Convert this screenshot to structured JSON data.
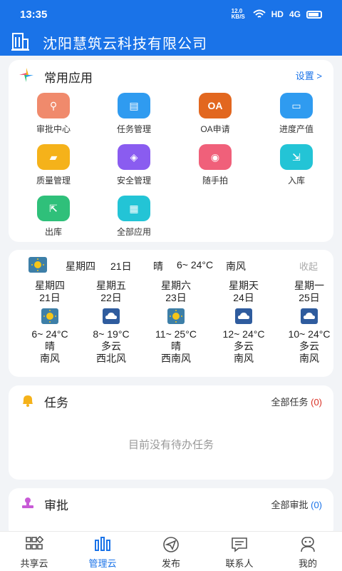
{
  "status_bar": {
    "time": "13:35",
    "net_speed": "12.0 KB/S",
    "hd": "HD",
    "signal": "4G"
  },
  "header": {
    "title": "沈阳慧筑云科技有限公司"
  },
  "apps": {
    "title": "常用应用",
    "settings": "设置 >",
    "items": [
      {
        "label": "审批中心",
        "icon": "stamp-icon",
        "color": "#f08a6c",
        "glyph": "⚲"
      },
      {
        "label": "任务管理",
        "icon": "clipboard-icon",
        "color": "#2f9bf0",
        "glyph": "▤"
      },
      {
        "label": "OA申请",
        "icon": "oa-icon",
        "color": "#e2671f",
        "glyph": "OA"
      },
      {
        "label": "进度产值",
        "icon": "progress-icon",
        "color": "#2f9bf0",
        "glyph": "▭"
      },
      {
        "label": "质量管理",
        "icon": "quality-folder-icon",
        "color": "#f5b21a",
        "glyph": "▰"
      },
      {
        "label": "安全管理",
        "icon": "shield-icon",
        "color": "#8a5cf0",
        "glyph": "◈"
      },
      {
        "label": "随手拍",
        "icon": "camera-icon",
        "color": "#f0607a",
        "glyph": "◉"
      },
      {
        "label": "入库",
        "icon": "stock-in-icon",
        "color": "#23c4d6",
        "glyph": "⇲"
      },
      {
        "label": "出库",
        "icon": "stock-out-icon",
        "color": "#2fc07a",
        "glyph": "⇱"
      },
      {
        "label": "全部应用",
        "icon": "all-apps-icon",
        "color": "#23c4d6",
        "glyph": "▦"
      }
    ]
  },
  "weather": {
    "today": {
      "weekday": "星期四",
      "date": "21日",
      "cond": "晴",
      "temp": "6~ 24°C",
      "wind": "南风"
    },
    "collapse": "收起",
    "days": [
      {
        "weekday": "星期四",
        "date": "21日",
        "icon": "sunny-icon",
        "temp": "6~ 24°C",
        "cond": "晴",
        "wind": "南风"
      },
      {
        "weekday": "星期五",
        "date": "22日",
        "icon": "cloudy-icon",
        "temp": "8~ 19°C",
        "cond": "多云",
        "wind": "西北风"
      },
      {
        "weekday": "星期六",
        "date": "23日",
        "icon": "sunny-icon",
        "temp": "11~ 25°C",
        "cond": "晴",
        "wind": "西南风"
      },
      {
        "weekday": "星期天",
        "date": "24日",
        "icon": "cloudy-icon",
        "temp": "12~ 24°C",
        "cond": "多云",
        "wind": "南风"
      },
      {
        "weekday": "星期一",
        "date": "25日",
        "icon": "cloudy-icon",
        "temp": "10~ 24°C",
        "cond": "多云",
        "wind": "南风"
      }
    ]
  },
  "tasks": {
    "title": "任务",
    "link": "全部任务",
    "count": "(0)",
    "empty": "目前没有待办任务"
  },
  "approvals": {
    "title": "审批",
    "link": "全部审批",
    "count": "(0)"
  },
  "tabbar": [
    {
      "label": "共享云",
      "icon": "share-cloud-icon",
      "active": false
    },
    {
      "label": "管理云",
      "icon": "manage-cloud-icon",
      "active": true
    },
    {
      "label": "发布",
      "icon": "paper-plane-icon",
      "active": false
    },
    {
      "label": "联系人",
      "icon": "chat-icon",
      "active": false
    },
    {
      "label": "我的",
      "icon": "profile-icon",
      "active": false
    }
  ]
}
